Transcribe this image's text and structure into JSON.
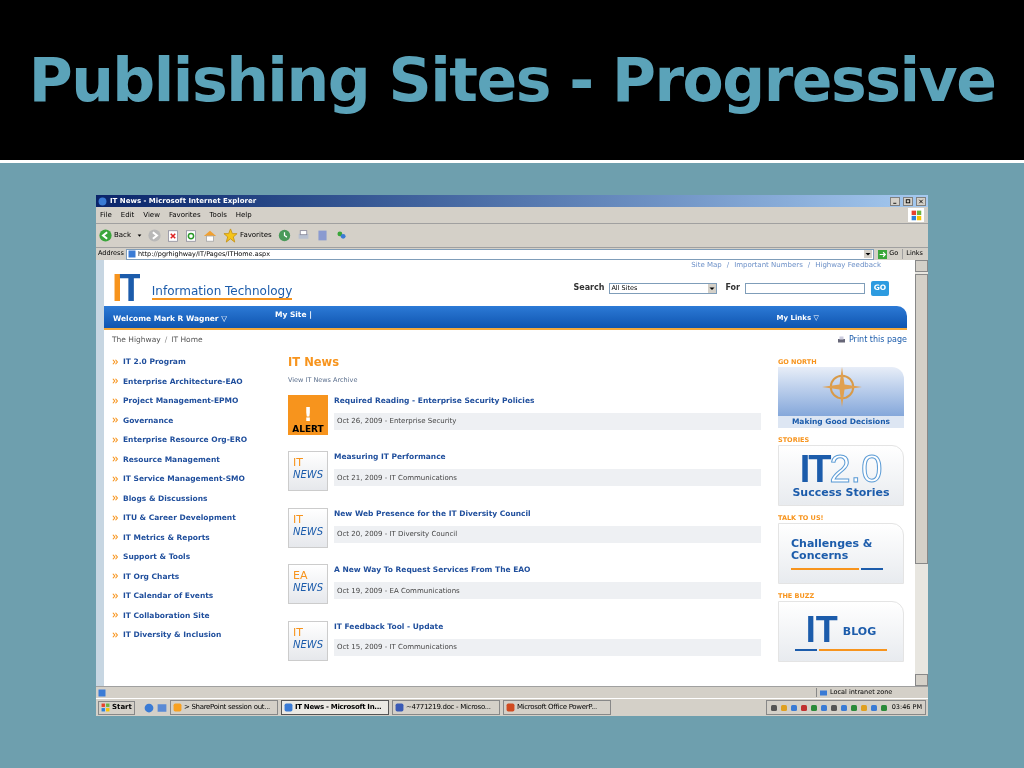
{
  "slide_title": "Publishing Sites - Progressive",
  "window": {
    "title": "IT News - Microsoft Internet Explorer"
  },
  "menu": [
    "File",
    "Edit",
    "View",
    "Favorites",
    "Tools",
    "Help"
  ],
  "toolbar": {
    "back": "Back",
    "favorites": "Favorites"
  },
  "address": {
    "label": "Address",
    "url": "http://pgrhighway/IT/Pages/ITHome.aspx",
    "go": "Go",
    "links": "Links"
  },
  "page": {
    "top_links": [
      {
        "label": "Site Map",
        "separator": "/"
      },
      {
        "label": "Important Numbers",
        "separator": "/"
      },
      {
        "label": "Highway Feedback"
      }
    ],
    "logo_mark": "IT",
    "logo_text": "Information Technology",
    "search": {
      "label": "Search",
      "scope": "All Sites",
      "for_label": "For",
      "button": "GO"
    },
    "nav": {
      "welcome": "Welcome Mark R Wagner ▽",
      "my_site": "My Site |",
      "my_links": "My Links ▽"
    },
    "breadcrumb": [
      {
        "label": "The Highway",
        "separator": "/"
      },
      {
        "label": "IT Home"
      }
    ],
    "print": "Print this page",
    "left_nav": [
      "IT 2.0 Program",
      "Enterprise Architecture-EAO",
      "Project Management-EPMO",
      "Governance",
      "Enterprise Resource Org-ERO",
      "Resource Management",
      "IT Service Management-SMO",
      "Blogs & Discussions",
      "ITU & Career Development",
      "IT Metrics & Reports",
      "Support & Tools",
      "IT Org Charts",
      "IT Calendar of Events",
      "IT Collaboration Site",
      "IT Diversity & Inclusion"
    ],
    "news": {
      "heading": "IT News",
      "archive": "View IT News Archive",
      "items": [
        {
          "badge": {
            "kind": "alert",
            "top": "!",
            "bottom": "ALERT"
          },
          "title": "Required Reading - Enterprise Security Policies",
          "meta": "Oct 26, 2009 - Enterprise Security"
        },
        {
          "badge": {
            "kind": "news",
            "top": "IT",
            "bottom": "NEWS"
          },
          "title": "Measuring IT Performance",
          "meta": "Oct 21, 2009 - IT Communications"
        },
        {
          "badge": {
            "kind": "news",
            "top": "IT",
            "bottom": "NEWS"
          },
          "title": "New Web Presence for the IT Diversity Council",
          "meta": "Oct 20, 2009 - IT Diversity Council"
        },
        {
          "badge": {
            "kind": "news",
            "top": "EA",
            "bottom": "NEWS"
          },
          "title": "A New Way To Request Services From The EAO",
          "meta": "Oct 19, 2009 - EA Communications"
        },
        {
          "badge": {
            "kind": "news",
            "top": "IT",
            "bottom": "NEWS"
          },
          "title": "IT Feedback Tool - Update",
          "meta": "Oct 15, 2009 - IT Communications"
        }
      ]
    },
    "banners": [
      {
        "kind": "compass",
        "label": "GO NORTH",
        "texts": [
          "Making Good Decisions"
        ]
      },
      {
        "kind": "it20",
        "label": "STORIES",
        "texts": [
          "IT",
          "2.0",
          "Success Stories"
        ]
      },
      {
        "kind": "talk",
        "label": "TALK TO US!",
        "texts": [
          "Challenges &",
          "Concerns"
        ]
      },
      {
        "kind": "blog",
        "label": "THE BUZZ",
        "texts": [
          "IT",
          "BLOG"
        ]
      }
    ]
  },
  "status_bar": {
    "zone": "Local intranet zone"
  },
  "taskbar": {
    "start": "Start",
    "tasks": [
      {
        "label": "> SharePoint session out...",
        "selected": false
      },
      {
        "label": "IT News - Microsoft In...",
        "selected": true
      },
      {
        "label": "~4771219.doc - Microso...",
        "selected": false
      },
      {
        "label": "Microsoft Office PowerP...",
        "selected": false
      }
    ],
    "clock": "03:46 PM"
  }
}
